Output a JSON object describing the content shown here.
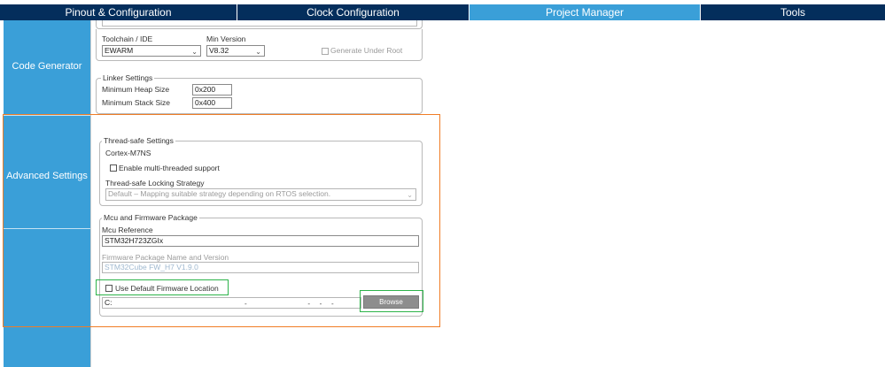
{
  "tabs": [
    {
      "label": "Pinout & Configuration"
    },
    {
      "label": "Clock Configuration"
    },
    {
      "label": "Project Manager"
    },
    {
      "label": "Tools"
    }
  ],
  "sidebar": {
    "items": [
      {
        "label": "Code Generator"
      },
      {
        "label": "Advanced Settings"
      }
    ]
  },
  "toolchain": {
    "label": "Toolchain / IDE",
    "value": "EWARM",
    "min_version_label": "Min Version",
    "min_version_value": "V8.32",
    "generate_under_root_label": "Generate Under Root"
  },
  "linker": {
    "legend": "Linker Settings",
    "heap_label": "Minimum Heap Size",
    "heap_value": "0x200",
    "stack_label": "Minimum Stack Size",
    "stack_value": "0x400"
  },
  "thread_safe": {
    "legend": "Thread-safe Settings",
    "core": "Cortex-M7NS",
    "enable_label": "Enable multi-threaded support",
    "strategy_label": "Thread-safe Locking Strategy",
    "strategy_value": "Default – Mapping suitable strategy depending on RTOS selection."
  },
  "mcu": {
    "legend": "Mcu and Firmware Package",
    "reference_label": "Mcu Reference",
    "reference_value": "STM32H723ZGIx",
    "package_label": "Firmware Package Name and Version",
    "package_value": "STM32Cube FW_H7 V1.9.0",
    "use_default_label": "Use Default Firmware Location",
    "location_value": "C:",
    "browse_label": "Browse"
  },
  "colors": {
    "tab_dark": "#042e5c",
    "tab_active": "#3a9fd8",
    "sidebar": "#3a9fd8",
    "highlight_orange": "#f07d26",
    "highlight_green": "#2db34a"
  }
}
